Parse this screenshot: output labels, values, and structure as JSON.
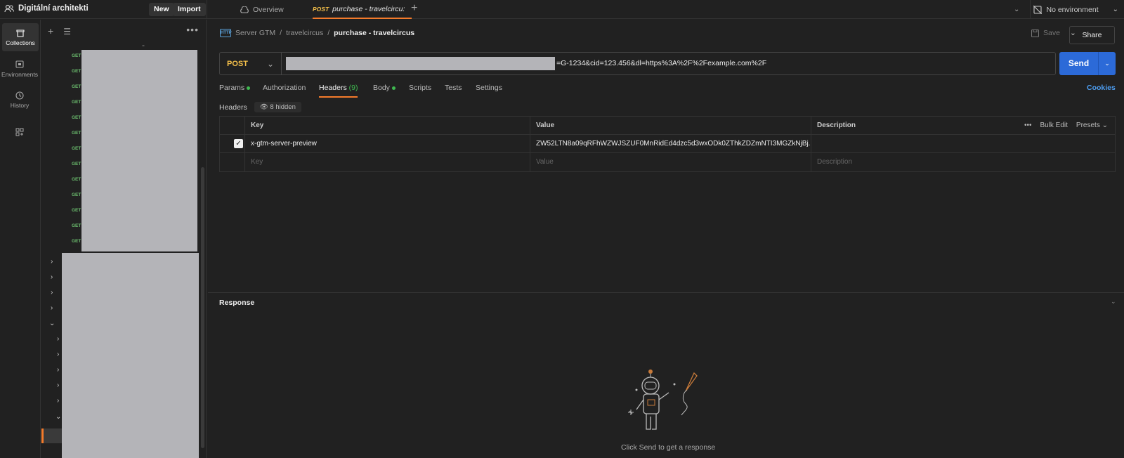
{
  "workspace": {
    "name": "Digitální architekti",
    "new_label": "New",
    "import_label": "Import"
  },
  "tabs": [
    {
      "label": "Overview",
      "icon": "overview-icon"
    },
    {
      "method": "POST",
      "label": "purchase - travelcircu:"
    }
  ],
  "environment": {
    "label": "No environment"
  },
  "rail": {
    "items": [
      {
        "label": "Collections",
        "icon": "collections-icon"
      },
      {
        "label": "Environments",
        "icon": "environments-icon"
      },
      {
        "label": "History",
        "icon": "history-icon"
      },
      {
        "label": "",
        "icon": "add-apps-icon"
      }
    ]
  },
  "sidebar": {
    "get_label": "GET",
    "get_count": 13,
    "dash": "-"
  },
  "breadcrumb": {
    "parent": "Server GTM",
    "folder": "travelcircus",
    "current": "purchase - travelcircus",
    "sep": "/"
  },
  "toolbar": {
    "save_label": "Save",
    "share_label": "Share"
  },
  "request": {
    "method": "POST",
    "url_visible": "=G-1234&cid=123.456&dl=https%3A%2F%2Fexample.com%2F",
    "send_label": "Send"
  },
  "req_tabs": {
    "params": "Params",
    "authorization": "Authorization",
    "headers": "Headers",
    "headers_count": "(9)",
    "body": "Body",
    "scripts": "Scripts",
    "tests": "Tests",
    "settings": "Settings",
    "cookies": "Cookies"
  },
  "headers_section": {
    "title": "Headers",
    "hidden": "8 hidden"
  },
  "table": {
    "col_key": "Key",
    "col_value": "Value",
    "col_desc": "Description",
    "bulk_edit": "Bulk Edit",
    "presets": "Presets",
    "row": {
      "key": "x-gtm-server-preview",
      "value": "ZW52LTN8a09qRFhWZWJSZUF0MnRidEd4dzc5d3wxODk0ZThkZDZmNTI3MGZkNjBj..."
    },
    "placeholder": {
      "key": "Key",
      "value": "Value",
      "desc": "Description"
    }
  },
  "response": {
    "title": "Response",
    "empty_message": "Click Send to get a response"
  }
}
